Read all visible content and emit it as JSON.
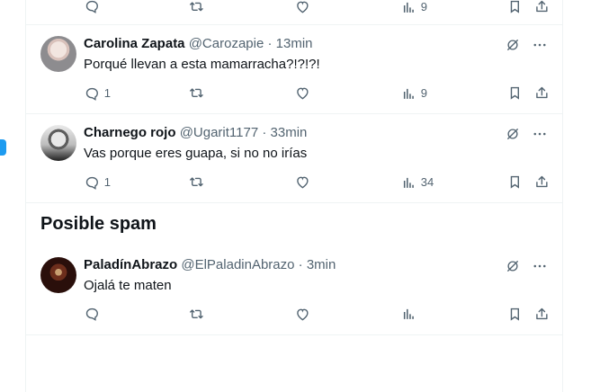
{
  "replies": [
    {
      "name": "Carolina Zapata",
      "handle": "@Carozapie",
      "separator": "·",
      "time": "13min",
      "text": "Porqué llevan a esta mamarracha?!?!?!",
      "reply_count": "1",
      "repost_count": "",
      "like_count": "",
      "view_count": "9"
    },
    {
      "name": "Charnego rojo",
      "handle": "@Ugarit1177",
      "separator": "·",
      "time": "33min",
      "text": "Vas porque eres guapa, si no no irías",
      "reply_count": "1",
      "repost_count": "",
      "like_count": "",
      "view_count": "34"
    },
    {
      "name": "PaladínAbrazo",
      "handle": "@ElPaladinAbrazo",
      "separator": "·",
      "time": "3min",
      "text": "Ojalá te maten",
      "reply_count": "",
      "repost_count": "",
      "like_count": "",
      "view_count": ""
    }
  ],
  "top_partial": {
    "view_count": "9"
  },
  "section": {
    "title": "Posible spam"
  },
  "icons": {
    "reply": "reply-icon",
    "repost": "repost-icon",
    "like": "heart-icon",
    "views": "views-icon",
    "bookmark": "bookmark-icon",
    "share": "share-icon",
    "grok": "grok-icon",
    "more": "more-icon"
  },
  "colors": {
    "text": "#0f1419",
    "muted": "#536471",
    "border": "#eff3f4",
    "accent": "#1d9bf0"
  }
}
